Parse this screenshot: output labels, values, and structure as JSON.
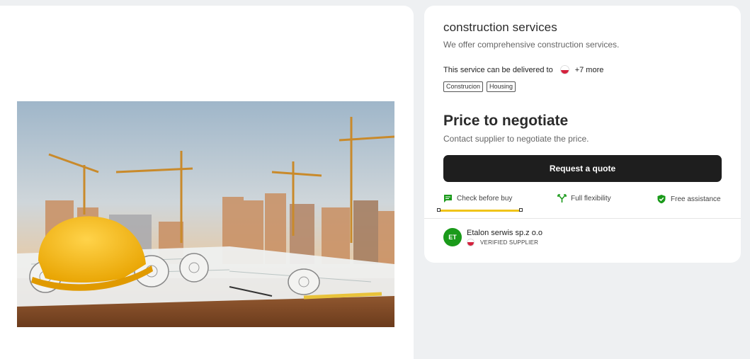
{
  "product": {
    "title": "construction services",
    "description": "We offer comprehensive construction services.",
    "delivery_label": "This service can be delivered to",
    "delivery_more": "+7 more",
    "tags": [
      "Construcion",
      "Housing"
    ]
  },
  "price": {
    "title": "Price to negotiate",
    "subtitle": "Contact supplier to negotiate the price."
  },
  "actions": {
    "request_quote_label": "Request a quote"
  },
  "features": [
    {
      "label": "Check before buy",
      "icon": "chat-icon"
    },
    {
      "label": "Full flexibility",
      "icon": "split-arrows-icon"
    },
    {
      "label": "Free assistance",
      "icon": "shield-check-icon"
    }
  ],
  "supplier": {
    "initials": "ET",
    "name": "Etalon serwis sp.z o.o",
    "badge": "VERIFIED SUPPLIER"
  },
  "colors": {
    "accent_green": "#1a9a1a",
    "button_dark": "#1e1e1e",
    "highlight_yellow": "#f0c419"
  }
}
